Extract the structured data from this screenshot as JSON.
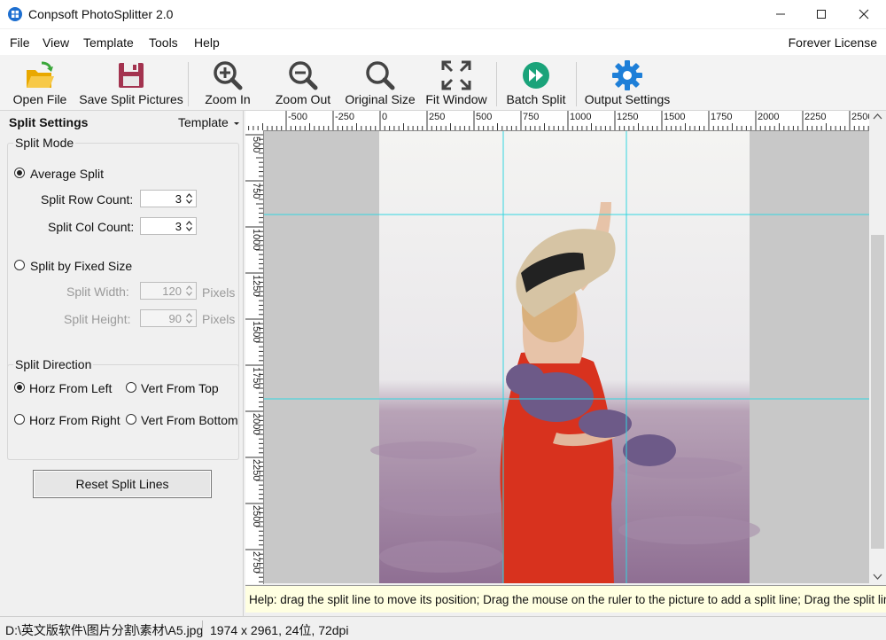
{
  "window": {
    "title": "Conpsoft PhotoSplitter 2.0"
  },
  "menu": {
    "items": [
      "File",
      "View",
      "Template",
      "Tools",
      "Help"
    ],
    "license": "Forever License"
  },
  "toolbar": {
    "open_file": "Open File",
    "save_split": "Save Split Pictures",
    "zoom_in": "Zoom In",
    "zoom_out": "Zoom Out",
    "original_size": "Original Size",
    "fit_window": "Fit Window",
    "batch_split": "Batch Split",
    "output_settings": "Output Settings"
  },
  "panel": {
    "title": "Split Settings",
    "template_label": "Template",
    "split_mode": {
      "title": "Split Mode",
      "average_split": "Average Split",
      "row_count_label": "Split Row Count:",
      "row_count": "3",
      "col_count_label": "Split Col Count:",
      "col_count": "3",
      "fixed_size": "Split by Fixed Size",
      "width_label": "Split Width:",
      "width": "120",
      "height_label": "Split Height:",
      "height": "90",
      "unit": "Pixels",
      "selected": "average"
    },
    "direction": {
      "title": "Split Direction",
      "horz_left": "Horz From Left",
      "vert_top": "Vert From Top",
      "horz_right": "Horz From Right",
      "vert_bottom": "Vert From Bottom",
      "selected": "horz_left"
    },
    "reset_label": "Reset Split Lines"
  },
  "ruler": {
    "top_labels": [
      "-500",
      "-250",
      "0",
      "250",
      "500",
      "750",
      "1000",
      "1250",
      "1500",
      "1750",
      "2000",
      "2250",
      "2500"
    ],
    "left_labels": [
      "500",
      "750",
      "1000",
      "1250",
      "1500",
      "1750",
      "2000",
      "2250",
      "2500",
      "2750"
    ]
  },
  "help": {
    "text": "Help: drag the split line to move its position; Drag the mouse on the ruler to the picture to add a split line; Drag the split line out of the picture to delete it"
  },
  "status": {
    "file": "D:\\英文版软件\\图片分割\\素材\\A5.jpg",
    "info": "1974 x 2961, 24位, 72dpi"
  },
  "colors": {
    "split_line": "#33d6e0",
    "accent_blue": "#1e7fd8",
    "play_green": "#1aa37a"
  }
}
